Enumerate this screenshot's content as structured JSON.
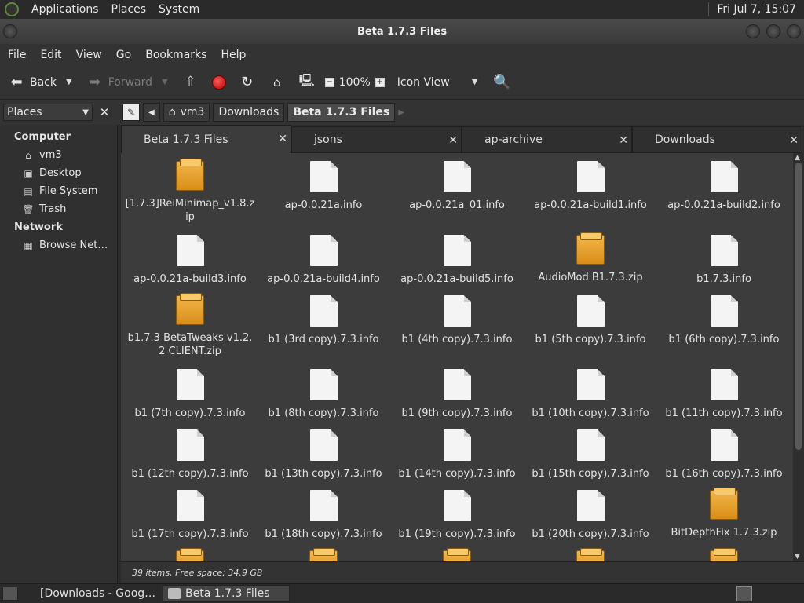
{
  "top_panel": {
    "menus": [
      "Applications",
      "Places",
      "System"
    ],
    "clock": "Fri Jul 7, 15:07"
  },
  "window": {
    "title": "Beta 1.7.3 Files"
  },
  "menubar": [
    "File",
    "Edit",
    "View",
    "Go",
    "Bookmarks",
    "Help"
  ],
  "toolbar": {
    "back": "Back",
    "forward": "Forward",
    "zoom": "100%",
    "view_mode": "Icon View"
  },
  "location": {
    "places_label": "Places",
    "crumbs": [
      "vm3",
      "Downloads",
      "Beta 1.7.3 Files"
    ]
  },
  "sidebar": {
    "computer_heading": "Computer",
    "computer_items": [
      {
        "label": "vm3",
        "icon": "home-icon"
      },
      {
        "label": "Desktop",
        "icon": "desktop-icon"
      },
      {
        "label": "File System",
        "icon": "filesystem-icon"
      },
      {
        "label": "Trash",
        "icon": "trash-icon"
      }
    ],
    "network_heading": "Network",
    "network_items": [
      {
        "label": "Browse Net…",
        "icon": "network-icon"
      }
    ]
  },
  "tabs": [
    {
      "label": "Beta 1.7.3 Files",
      "active": true
    },
    {
      "label": "jsons",
      "active": false
    },
    {
      "label": "ap-archive",
      "active": false
    },
    {
      "label": "Downloads",
      "active": false
    }
  ],
  "files": [
    {
      "name": "[1.7.3]ReiMinimap_v1.8.zip",
      "type": "zip"
    },
    {
      "name": "ap-0.0.21a.info",
      "type": "doc"
    },
    {
      "name": "ap-0.0.21a_01.info",
      "type": "doc"
    },
    {
      "name": "ap-0.0.21a-build1.info",
      "type": "doc"
    },
    {
      "name": "ap-0.0.21a-build2.info",
      "type": "doc"
    },
    {
      "name": "ap-0.0.21a-build3.info",
      "type": "doc"
    },
    {
      "name": "ap-0.0.21a-build4.info",
      "type": "doc"
    },
    {
      "name": "ap-0.0.21a-build5.info",
      "type": "doc"
    },
    {
      "name": "AudioMod B1.7.3.zip",
      "type": "zip"
    },
    {
      "name": "b1.7.3.info",
      "type": "doc"
    },
    {
      "name": "b1.7.3 BetaTweaks v1.2.2 CLIENT.zip",
      "type": "zip"
    },
    {
      "name": "b1 (3rd copy).7.3.info",
      "type": "doc"
    },
    {
      "name": "b1 (4th copy).7.3.info",
      "type": "doc"
    },
    {
      "name": "b1 (5th copy).7.3.info",
      "type": "doc"
    },
    {
      "name": "b1 (6th copy).7.3.info",
      "type": "doc"
    },
    {
      "name": "b1 (7th copy).7.3.info",
      "type": "doc"
    },
    {
      "name": "b1 (8th copy).7.3.info",
      "type": "doc"
    },
    {
      "name": "b1 (9th copy).7.3.info",
      "type": "doc"
    },
    {
      "name": "b1 (10th copy).7.3.info",
      "type": "doc"
    },
    {
      "name": "b1 (11th copy).7.3.info",
      "type": "doc"
    },
    {
      "name": "b1 (12th copy).7.3.info",
      "type": "doc"
    },
    {
      "name": "b1 (13th copy).7.3.info",
      "type": "doc"
    },
    {
      "name": "b1 (14th copy).7.3.info",
      "type": "doc"
    },
    {
      "name": "b1 (15th copy).7.3.info",
      "type": "doc"
    },
    {
      "name": "b1 (16th copy).7.3.info",
      "type": "doc"
    },
    {
      "name": "b1 (17th copy).7.3.info",
      "type": "doc"
    },
    {
      "name": "b1 (18th copy).7.3.info",
      "type": "doc"
    },
    {
      "name": "b1 (19th copy).7.3.info",
      "type": "doc"
    },
    {
      "name": "b1 (20th copy).7.3.info",
      "type": "doc"
    },
    {
      "name": "BitDepthFix 1.7.3.zip",
      "type": "zip"
    },
    {
      "name": "",
      "type": "zip"
    },
    {
      "name": "",
      "type": "zip"
    },
    {
      "name": "",
      "type": "zip"
    },
    {
      "name": "",
      "type": "zip"
    },
    {
      "name": "",
      "type": "zip"
    }
  ],
  "status": "39 items, Free space: 34.9 GB",
  "taskbar": [
    {
      "label": "[Downloads - Goog…",
      "icon": "chrome-icon",
      "active": false
    },
    {
      "label": "Beta 1.7.3 Files",
      "icon": "folder-icon",
      "active": true
    }
  ]
}
